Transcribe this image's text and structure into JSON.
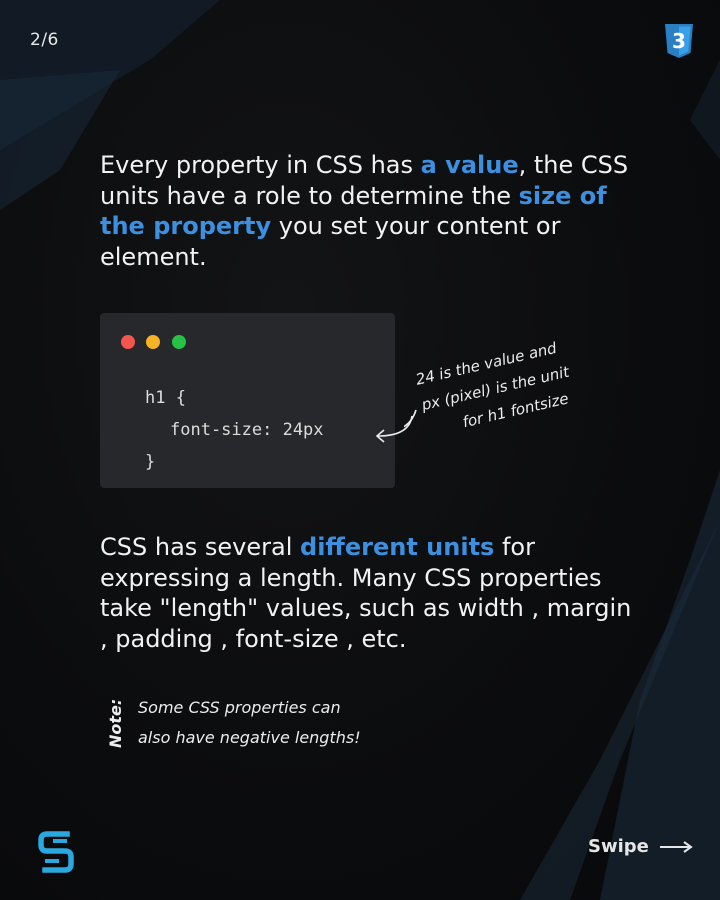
{
  "header": {
    "page_indicator": "2/6",
    "badge_icon": "css3-icon",
    "badge_label": "3"
  },
  "intro": {
    "t1": "Every property in CSS has ",
    "h1": "a value",
    "t2": ", the CSS units have a role to determine the ",
    "h2": "size of the property",
    "t3": " you set your content or element."
  },
  "code_example": {
    "line1": "h1 {",
    "line2": "font-size: 24px",
    "line3": "}"
  },
  "annotation": {
    "line1": "24 is the value and",
    "line2": "px (pixel) is the unit",
    "line3": "for h1 fontsize"
  },
  "units": {
    "t1": "CSS has several ",
    "h1": "different units",
    "t2": " for expressing a length. Many CSS properties take \"length\" values, such as width , margin , padding , font-size , etc."
  },
  "note": {
    "label": "Note:",
    "line1": "Some CSS properties can",
    "line2": "also have negative lengths!"
  },
  "footer": {
    "swipe_label": "Swipe"
  },
  "colors": {
    "accent": "#3d8fe0",
    "logo": "#2aa8e0",
    "badge": "#2a7fc4"
  }
}
